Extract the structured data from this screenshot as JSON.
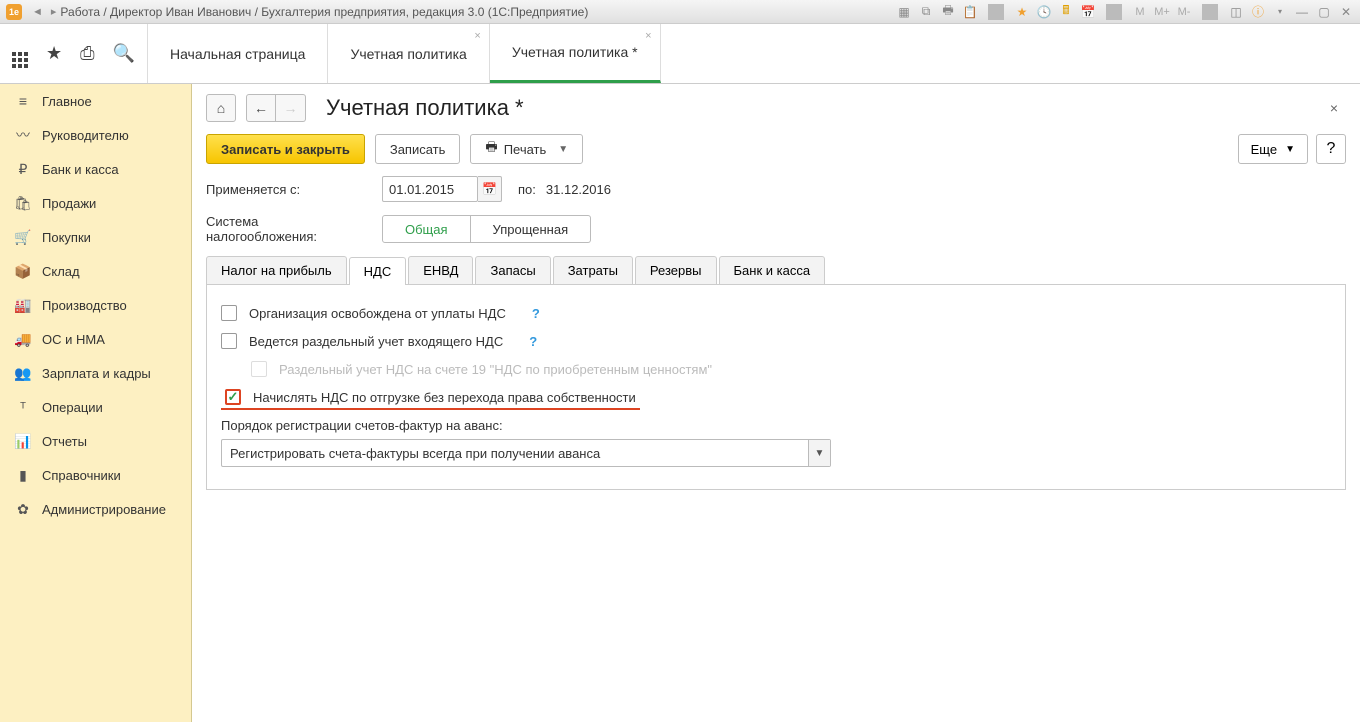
{
  "title": "Работа / Директор Иван Иванович / Бухгалтерия предприятия, редакция 3.0  (1С:Предприятие)",
  "top_tabs": {
    "start": "Начальная страница",
    "t1": "Учетная политика",
    "t2": "Учетная политика *"
  },
  "sidebar": [
    {
      "icon": "≡",
      "label": "Главное"
    },
    {
      "icon": "📈",
      "label": "Руководителю"
    },
    {
      "icon": "₽",
      "label": "Банк и касса"
    },
    {
      "icon": "🛍",
      "label": "Продажи"
    },
    {
      "icon": "🛒",
      "label": "Покупки"
    },
    {
      "icon": "📦",
      "label": "Склад"
    },
    {
      "icon": "🏭",
      "label": "Производство"
    },
    {
      "icon": "🚚",
      "label": "ОС и НМА"
    },
    {
      "icon": "👥",
      "label": "Зарплата и кадры"
    },
    {
      "icon": "⚙",
      "label": "Операции"
    },
    {
      "icon": "📊",
      "label": "Отчеты"
    },
    {
      "icon": "📚",
      "label": "Справочники"
    },
    {
      "icon": "✿",
      "label": "Администрирование"
    }
  ],
  "page": {
    "title": "Учетная политика *",
    "save_close": "Записать и закрыть",
    "save": "Записать",
    "print": "Печать",
    "more": "Еще",
    "applies_from_label": "Применяется с:",
    "date_from": "01.01.2015",
    "to_label": "по:",
    "date_to": "31.12.2016",
    "tax_system_label": "Система налогообложения:",
    "tax_system_general": "Общая",
    "tax_system_simplified": "Упрощенная"
  },
  "subtabs": [
    "Налог на прибыль",
    "НДС",
    "ЕНВД",
    "Запасы",
    "Затраты",
    "Резервы",
    "Банк и касса"
  ],
  "nds": {
    "exempt": "Организация освобождена от уплаты НДС",
    "split": "Ведется раздельный учет входящего НДС",
    "split_sub": "Раздельный учет НДС на счете 19 \"НДС по приобретенным ценностям\"",
    "accrue": "Начислять НДС по отгрузке без перехода права собственности",
    "invoice_order_label": "Порядок регистрации счетов-фактур на аванс:",
    "invoice_order_value": "Регистрировать счета-фактуры всегда при получении аванса"
  }
}
